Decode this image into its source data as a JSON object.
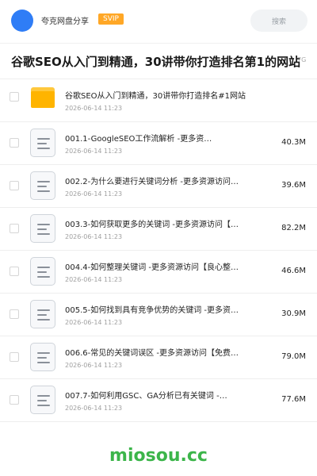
{
  "header": {
    "username": "夸克网盘分享",
    "vip_badge": "SVIP",
    "search_label": "搜索"
  },
  "title": {
    "text": "谷歌SEO从入门到精通，30讲带你打造排名第1的网站",
    "size": "7G"
  },
  "files": [
    {
      "type": "folder",
      "name": "谷歌SEO从入门到精通，30讲带你打造排名#1网站",
      "date": "2026-06-14 11:23",
      "size": ""
    },
    {
      "type": "file",
      "name": "001.1-GoogleSEO工作流解析 -更多资…",
      "date": "2026-06-14 11:23",
      "size": "40.3M"
    },
    {
      "type": "file",
      "name": "002.2-为什么要进行关键词分析 -更多资源访问…",
      "date": "2026-06-14 11:23",
      "size": "39.6M"
    },
    {
      "type": "file",
      "name": "003.3-如何获取更多的关键词 -更多资源访问【…",
      "date": "2026-06-14 11:23",
      "size": "82.2M"
    },
    {
      "type": "file",
      "name": "004.4-如何整理关键词 -更多资源访问【良心整…",
      "date": "2026-06-14 11:23",
      "size": "46.6M"
    },
    {
      "type": "file",
      "name": "005.5-如何找到具有竞争优势的关键词 -更多资…",
      "date": "2026-06-14 11:23",
      "size": "30.9M"
    },
    {
      "type": "file",
      "name": "006.6-常见的关键词误区 -更多资源访问【免费…",
      "date": "2026-06-14 11:23",
      "size": "79.0M"
    },
    {
      "type": "file",
      "name": "007.7-如何利用GSC、GA分析已有关键词 -…",
      "date": "2026-06-14 11:23",
      "size": "77.6M"
    }
  ],
  "watermark": "miosou.cc",
  "colors": {
    "avatar": "#2f7df6",
    "vip": "#ffa726",
    "folder": "#ffb400",
    "watermark": "#3cb54a"
  },
  "icons": {
    "folder": "folder-icon",
    "file": "document-icon"
  }
}
